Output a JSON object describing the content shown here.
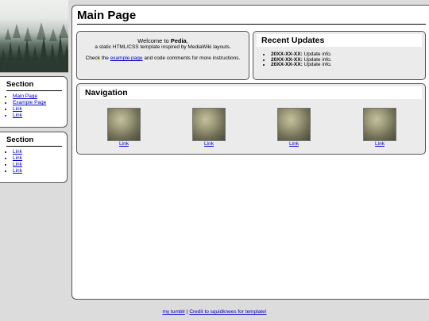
{
  "sidebar": {
    "banner_alt": "foggy forest",
    "sections": [
      {
        "title": "Section",
        "links": [
          "Main Page",
          "Example Page",
          "Link",
          "Link"
        ]
      },
      {
        "title": "Section",
        "links": [
          "Link",
          "Link",
          "Link",
          "Link"
        ]
      }
    ]
  },
  "main": {
    "title": "Main Page",
    "welcome": {
      "prefix": "Welcome to ",
      "site_name": "Pedia",
      "suffix": ",",
      "subtitle": "a static HTML/CSS template inspired by MediaWiki layouts.",
      "check_prefix": "Check the ",
      "check_link": "example page",
      "check_suffix": " and code comments for more instructions."
    },
    "updates": {
      "title": "Recent Updates",
      "items": [
        {
          "date": "20XX-XX-XX:",
          "text": " Update info."
        },
        {
          "date": "20XX-XX-XX:",
          "text": " Update info."
        },
        {
          "date": "20XX-XX-XX:",
          "text": " Update info."
        }
      ]
    },
    "navigation": {
      "title": "Navigation",
      "items": [
        {
          "label": "Link",
          "icon": "thumbnail-image"
        },
        {
          "label": "Link",
          "icon": "thumbnail-image"
        },
        {
          "label": "Link",
          "icon": "thumbnail-image"
        },
        {
          "label": "Link",
          "icon": "thumbnail-image"
        }
      ]
    }
  },
  "footer": {
    "link1": "my tumblr",
    "separator": " | ",
    "link2": "Credit to squidknees for template!"
  }
}
